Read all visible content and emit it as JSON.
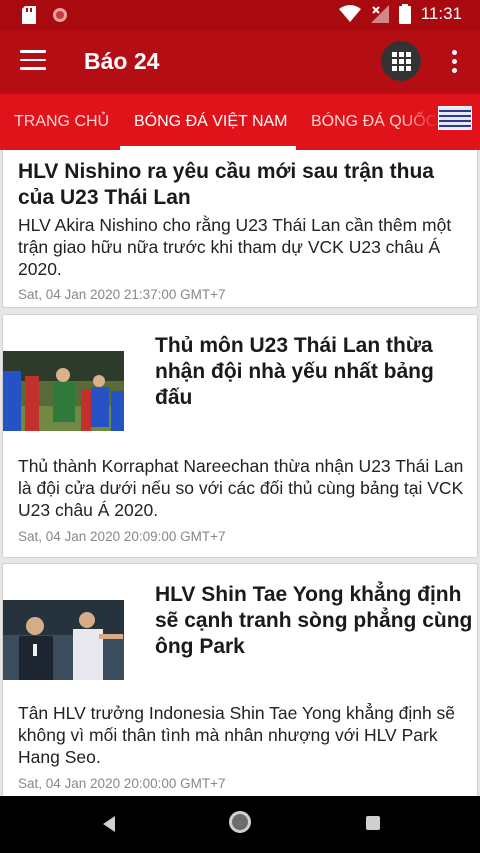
{
  "status_bar": {
    "time": "11:31",
    "icons": [
      "sd-card-icon",
      "record-icon",
      "wifi-icon",
      "signal-off-icon",
      "battery-icon"
    ]
  },
  "app_bar": {
    "title": "Báo 24",
    "menu_icon": "hamburger-menu-icon",
    "grid_icon": "grid-apps-icon",
    "more_icon": "more-vertical-icon"
  },
  "tabs": [
    {
      "label": "TRANG CHỦ",
      "active": false
    },
    {
      "label": "BÓNG ĐÁ VIỆT NAM",
      "active": true
    },
    {
      "label": "BÓNG ĐÁ QUỐC TẾ",
      "active": false
    }
  ],
  "articles": [
    {
      "title": "HLV Nishino ra yêu cầu mới sau trận thua của U23 Thái Lan",
      "summary": "HLV Akira Nishino cho rằng U23 Thái Lan cần thêm một trận giao hữu nữa trước khi tham dự VCK U23 châu Á 2020.",
      "date": "Sat, 04 Jan 2020 21:37:00 GMT+7"
    },
    {
      "title": "Thủ môn U23 Thái Lan thừa nhận đội nhà yếu nhất bảng đấu",
      "summary": "Thủ thành Korraphat Nareechan thừa nhận U23 Thái Lan là đội cửa dưới nếu so với các đối thủ cùng bảng tại VCK U23 châu Á 2020.",
      "date": "Sat, 04 Jan 2020 20:09:00 GMT+7"
    },
    {
      "title": "HLV Shin Tae Yong khẳng định sẽ cạnh tranh sòng phẳng cùng ông Park",
      "summary": "Tân HLV trưởng Indonesia Shin Tae Yong khẳng định sẽ không vì mối thân tình mà nhân nhượng với HLV Park Hang Seo.",
      "date": "Sat, 04 Jan 2020 20:00:00 GMT+7"
    }
  ],
  "colors": {
    "status_bar": "#a90a10",
    "app_bar": "#b50d14",
    "tab_bar": "#e0121a",
    "card_bg": "#ffffff",
    "page_bg": "#e6e6e6"
  },
  "nav_bar": {
    "back_icon": "back-triangle-icon",
    "home_icon": "home-circle-icon",
    "recents_icon": "recents-square-icon"
  }
}
